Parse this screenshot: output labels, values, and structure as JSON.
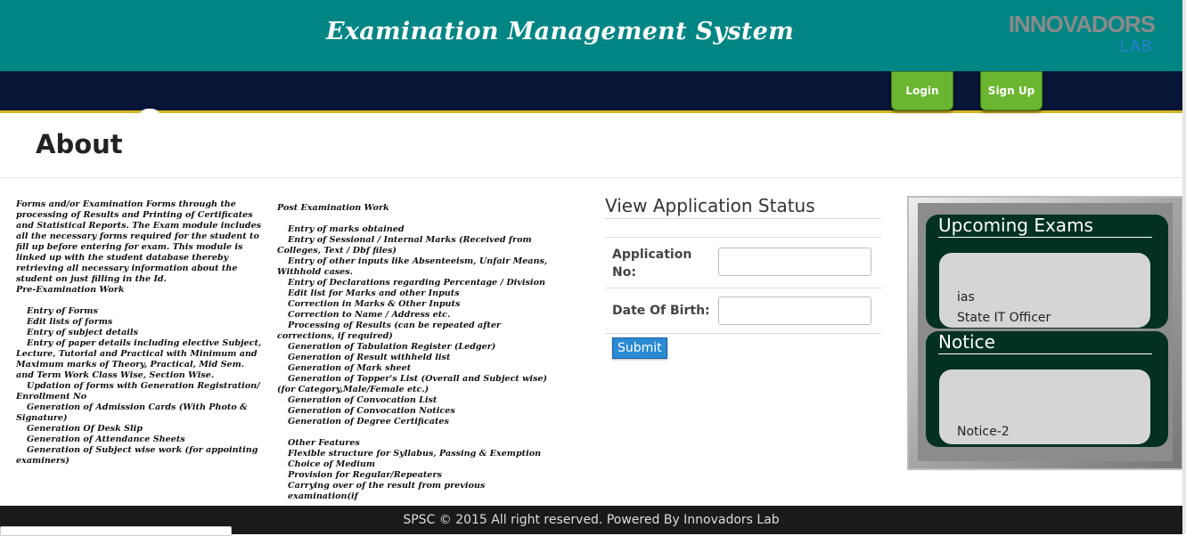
{
  "header": {
    "title": "Examination Management System",
    "logo_main": "INNOVADORS",
    "logo_sub": "LAB"
  },
  "nav": {
    "login": "Login",
    "signup": "Sign Up"
  },
  "about": {
    "title": "About"
  },
  "col1": [
    "Forms and/or Examination Forms through the processing of Results and Printing of Certificates and Statistical Reports. The Exam module includes all the necessary forms required for the student to fill up before entering for exam. This module is linked up with the student database thereby retrieving all necessary information about the student on just filling in the Id.",
    "Pre-Examination Work",
    "Entry of Forms",
    "Edit lists of forms",
    "Entry of subject details",
    "Entry of paper details including elective Subject, Lecture, Tutorial and Practical with Minimum and Maximum marks of Theory, Practical, Mid Sem. and Term Work Class Wise, Section Wise.",
    "Updation of forms with Generation Registration/ Enrollment No",
    "Generation of Admission Cards (With Photo & Signature)",
    "Generation Of Desk Slip",
    "Generation of Attendance Sheets",
    "Generation of Subject wise work (for appointing examiners)"
  ],
  "col2": [
    "Post Examination Work",
    "Entry of marks obtained",
    "Entry of Sessional / Internal Marks (Received from Colleges, Text / Dbf files)",
    "Entry of other inputs like Absenteeism, Unfair Means, Withhold cases.",
    "Entry of Declarations regarding Percentage / Division",
    "Edit list for Marks and other Inputs",
    "Correction in Marks & Other Inputs",
    "Correction to Name / Address etc.",
    "Processing of Results (can be repeated after corrections, if required)",
    "Generation of Tabulation Register (Ledger)",
    "Generation of Result withheld list",
    "Generation of Mark sheet",
    "Generation of Topper's List (Overall and Subject wise) (for Category,Male/Female etc.)",
    "Generation of Convocation List",
    "Generation of Convocation Notices",
    "Generation of Degree Certificates",
    "Other Features",
    "Flexible structure for Syllabus, Passing & Exemption",
    "Choice of Medium",
    "Provision for Regular/Repeaters",
    "Carrying over of the result from previous examination(if"
  ],
  "status": {
    "title": "View Application Status",
    "app_label": "Application No:",
    "dob_label": "Date Of Birth:",
    "app_value": "",
    "dob_value": "",
    "submit": "Submit"
  },
  "upcoming": {
    "title": "Upcoming Exams",
    "items": [
      "ias",
      "State IT Officer"
    ]
  },
  "notice": {
    "title": "Notice",
    "items": [
      "Notice-2"
    ]
  },
  "footer": {
    "text": "SPSC © 2015 All right reserved. Powered By Innovadors Lab"
  },
  "colors": {
    "header": "#008585",
    "navbar": "#071537",
    "nav_button": "#6ab630",
    "card": "#023124",
    "submit": "#2a8ad4"
  }
}
